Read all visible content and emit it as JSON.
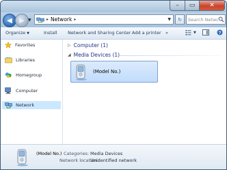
{
  "window": {
    "minimize_glyph": "–",
    "maximize_glyph": "▭",
    "close_glyph": "✕"
  },
  "address": {
    "location": "Network",
    "separator": "▸",
    "search_placeholder": "Search Network"
  },
  "toolbar": {
    "organize": "Organize",
    "install": "Install",
    "network_sharing_center": "Network and Sharing Center",
    "add_printer": "Add a printer",
    "more": "»"
  },
  "nav": {
    "favorites": "Favorites",
    "libraries": "Libraries",
    "homegroup": "Homegroup",
    "computer": "Computer",
    "network": "Network"
  },
  "content": {
    "groups": [
      {
        "label": "Computer (1)",
        "expanded": false
      },
      {
        "label": "Media Devices (1)",
        "expanded": true
      }
    ],
    "device": {
      "label": "(Model No.)"
    }
  },
  "details": {
    "name": "(Model No.)",
    "categories_label": "Categories:",
    "categories_value": "Media Devices",
    "location_label": "Network location:",
    "location_value": "Unidentified network"
  },
  "colors": {
    "selection": "#cce8ff",
    "link_blue": "#1e3287",
    "close_red": "#c9432a"
  }
}
